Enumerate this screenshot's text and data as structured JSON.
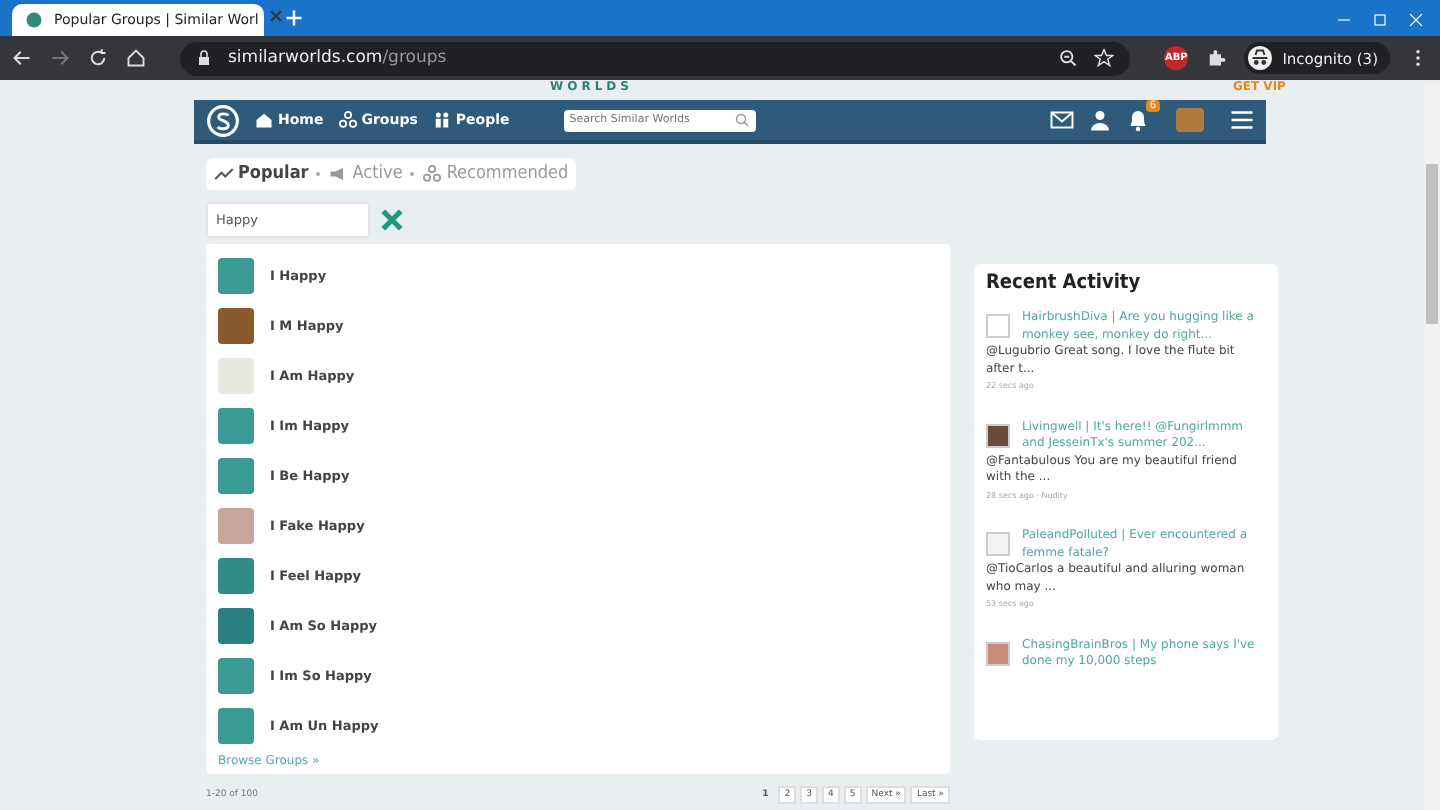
{
  "browser": {
    "tab_title": "Popular Groups | Similar Worl",
    "url_host": "similarworlds.com",
    "url_path": "/groups",
    "profile": "Incognito (3)",
    "extension_badge": "ABP"
  },
  "site_header": {
    "logo_text": "WORLDS",
    "vip": "GET VIP"
  },
  "nav": {
    "items": [
      "Home",
      "Groups",
      "People"
    ],
    "search_placeholder": "Search Similar Worlds",
    "notification_count": "6"
  },
  "filter_tabs": [
    {
      "label": "Popular",
      "selected": true
    },
    {
      "label": "Active",
      "selected": false
    },
    {
      "label": "Recommended",
      "selected": false
    }
  ],
  "group_search": {
    "value": "Happy"
  },
  "groups": [
    {
      "name": "I Happy",
      "color": "#3a9a94"
    },
    {
      "name": "I M Happy",
      "color": "#8a5a2e"
    },
    {
      "name": "I Am Happy",
      "color": "#e8e8e0"
    },
    {
      "name": "I Im Happy",
      "color": "#3a9a94"
    },
    {
      "name": "I Be Happy",
      "color": "#3a9a94"
    },
    {
      "name": "I Fake Happy",
      "color": "#c9a49a"
    },
    {
      "name": "I Feel Happy",
      "color": "#2f8c88"
    },
    {
      "name": "I Am So Happy",
      "color": "#2a7f80"
    },
    {
      "name": "I Im So Happy",
      "color": "#3a9a94"
    },
    {
      "name": "I Am Un Happy",
      "color": "#3a9a94"
    }
  ],
  "browse_link": "Browse Groups »",
  "pagination": {
    "range": "1-20 of 100",
    "pages": [
      {
        "label": "1",
        "selected": true
      },
      {
        "label": "2",
        "selected": false
      },
      {
        "label": "3",
        "selected": false
      },
      {
        "label": "4",
        "selected": false
      },
      {
        "label": "5",
        "selected": false
      },
      {
        "label": "Next »",
        "selected": false
      },
      {
        "label": "Last »",
        "selected": false
      }
    ]
  },
  "recent_activity": {
    "title": "Recent Activity",
    "items": [
      {
        "link": "HairbrushDiva | Are you hugging like a monkey see, monkey do right...",
        "comment": "@Lugubrio Great song. I love the flute bit after t...",
        "time": "22 secs ago",
        "color": "#ffffff"
      },
      {
        "link": "Livingwell | It's here!! @Fungirlmmm and JesseinTx's summer 202...",
        "comment": "@Fantabulous You are my beautiful friend with the ...",
        "time": "28 secs ago · Nudity",
        "color": "#6a4a3a"
      },
      {
        "link": "PaleandPolluted | Ever encountered a femme fatale?",
        "comment": "@TioCarlos a beautiful and alluring woman who may ...",
        "time": "53 secs ago",
        "color": "#f4f4f4"
      },
      {
        "link": "ChasingBrainBros | My phone says I've done my 10,000 steps",
        "color": "#c98a7a"
      }
    ]
  }
}
